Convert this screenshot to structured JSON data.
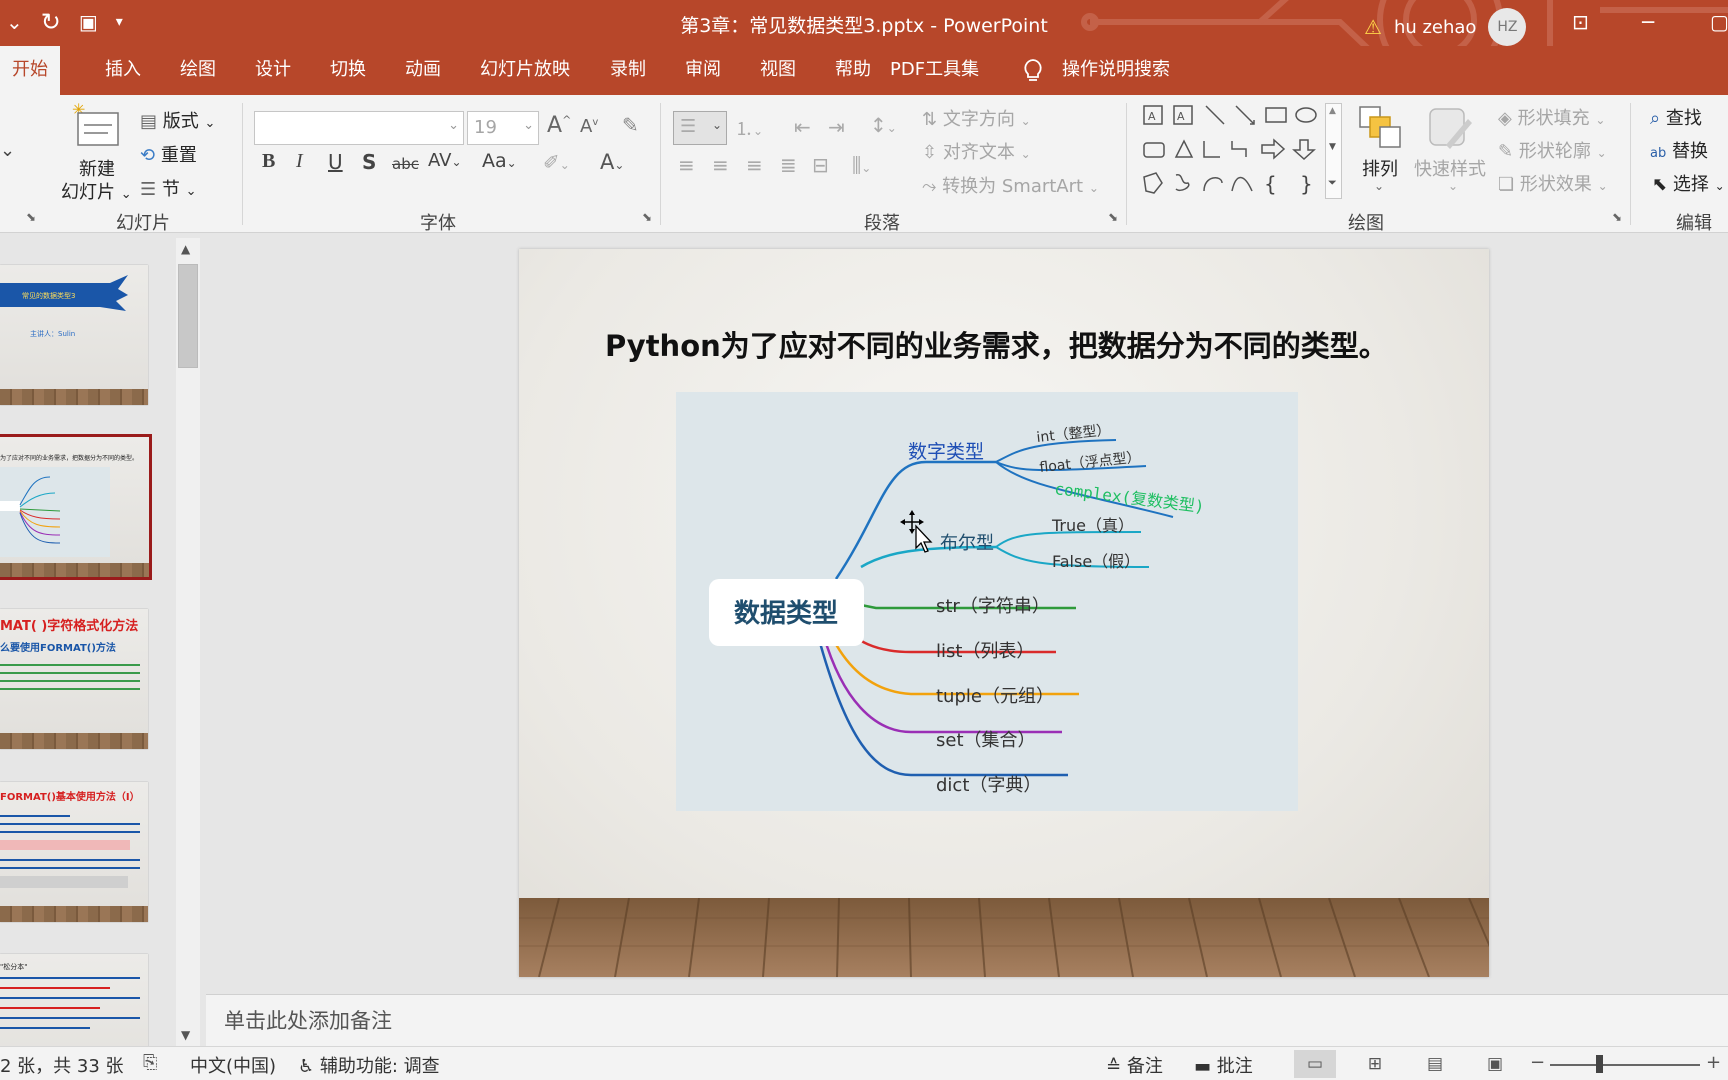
{
  "window": {
    "title": "第3章：常见数据类型3.pptx  -  PowerPoint",
    "user_name": "hu zehao",
    "user_initials": "HZ"
  },
  "ribbon_tabs": [
    "开始",
    "插入",
    "绘图",
    "设计",
    "切换",
    "动画",
    "幻灯片放映",
    "录制",
    "审阅",
    "视图",
    "帮助",
    "PDF工具集"
  ],
  "active_tab": "开始",
  "tell_me": "操作说明搜索",
  "ribbon": {
    "slides_group": {
      "new_slide_line1": "新建",
      "new_slide_line2": "幻灯片",
      "layout": "版式",
      "reset": "重置",
      "section": "节",
      "label": "幻灯片"
    },
    "font_group": {
      "font_size": "19",
      "label": "字体"
    },
    "paragraph_group": {
      "text_direction": "文字方向",
      "align_text": "对齐文本",
      "convert_smartart": "转换为 SmartArt",
      "label": "段落"
    },
    "drawing_group": {
      "arrange": "排列",
      "quick_styles": "快速样式",
      "shape_fill": "形状填充",
      "shape_outline": "形状轮廓",
      "shape_effects": "形状效果",
      "label": "绘图"
    },
    "editing_group": {
      "find": "查找",
      "replace": "替换",
      "select": "选择",
      "label": "编辑"
    }
  },
  "thumbnails": [
    {
      "title": "常见的数据类型3",
      "subtitle": "主讲人：Sulin"
    },
    {
      "title": "为了应对不同的业务需求，把数据分为不同的类型。"
    },
    {
      "title": "MAT( )字符格式化方法",
      "subtitle": "么要使用FORMAT()方法"
    },
    {
      "title": "FORMAT()基本使用方法（I）"
    },
    {
      "title": "\"松分本\""
    }
  ],
  "slide": {
    "heading": "Python为了应对不同的业务需求，把数据分为不同的类型。",
    "mindmap": {
      "root": "数据类型",
      "number_branch": "数字类型",
      "number_children": [
        "int（整型）",
        "float（浮点型）",
        "complex(复数类型)"
      ],
      "bool_branch": "布尔型",
      "bool_children": [
        "True（真）",
        "False（假）"
      ],
      "others": [
        "str（字符串）",
        "list（列表）",
        "tuple（元组）",
        "set（集合）",
        "dict（字典）"
      ]
    }
  },
  "notes_placeholder": "单击此处添加备注",
  "status": {
    "slide_count": "2 张，共 33 张",
    "language": "中文(中国)",
    "accessibility": "辅助功能: 调查",
    "notes_btn": "备注",
    "comments_btn": "批注"
  },
  "colors": {
    "ribbon_red": "#b7472a",
    "number_blue": "#1f73c0",
    "bool_cyan": "#1aa7c6",
    "str_green": "#2e9a3b",
    "list_red": "#d92b2b",
    "tuple_orange": "#f2a20d",
    "set_purple": "#9a2fb5",
    "dict_blue": "#1f5fb0",
    "complex_green": "#1fbf62"
  }
}
